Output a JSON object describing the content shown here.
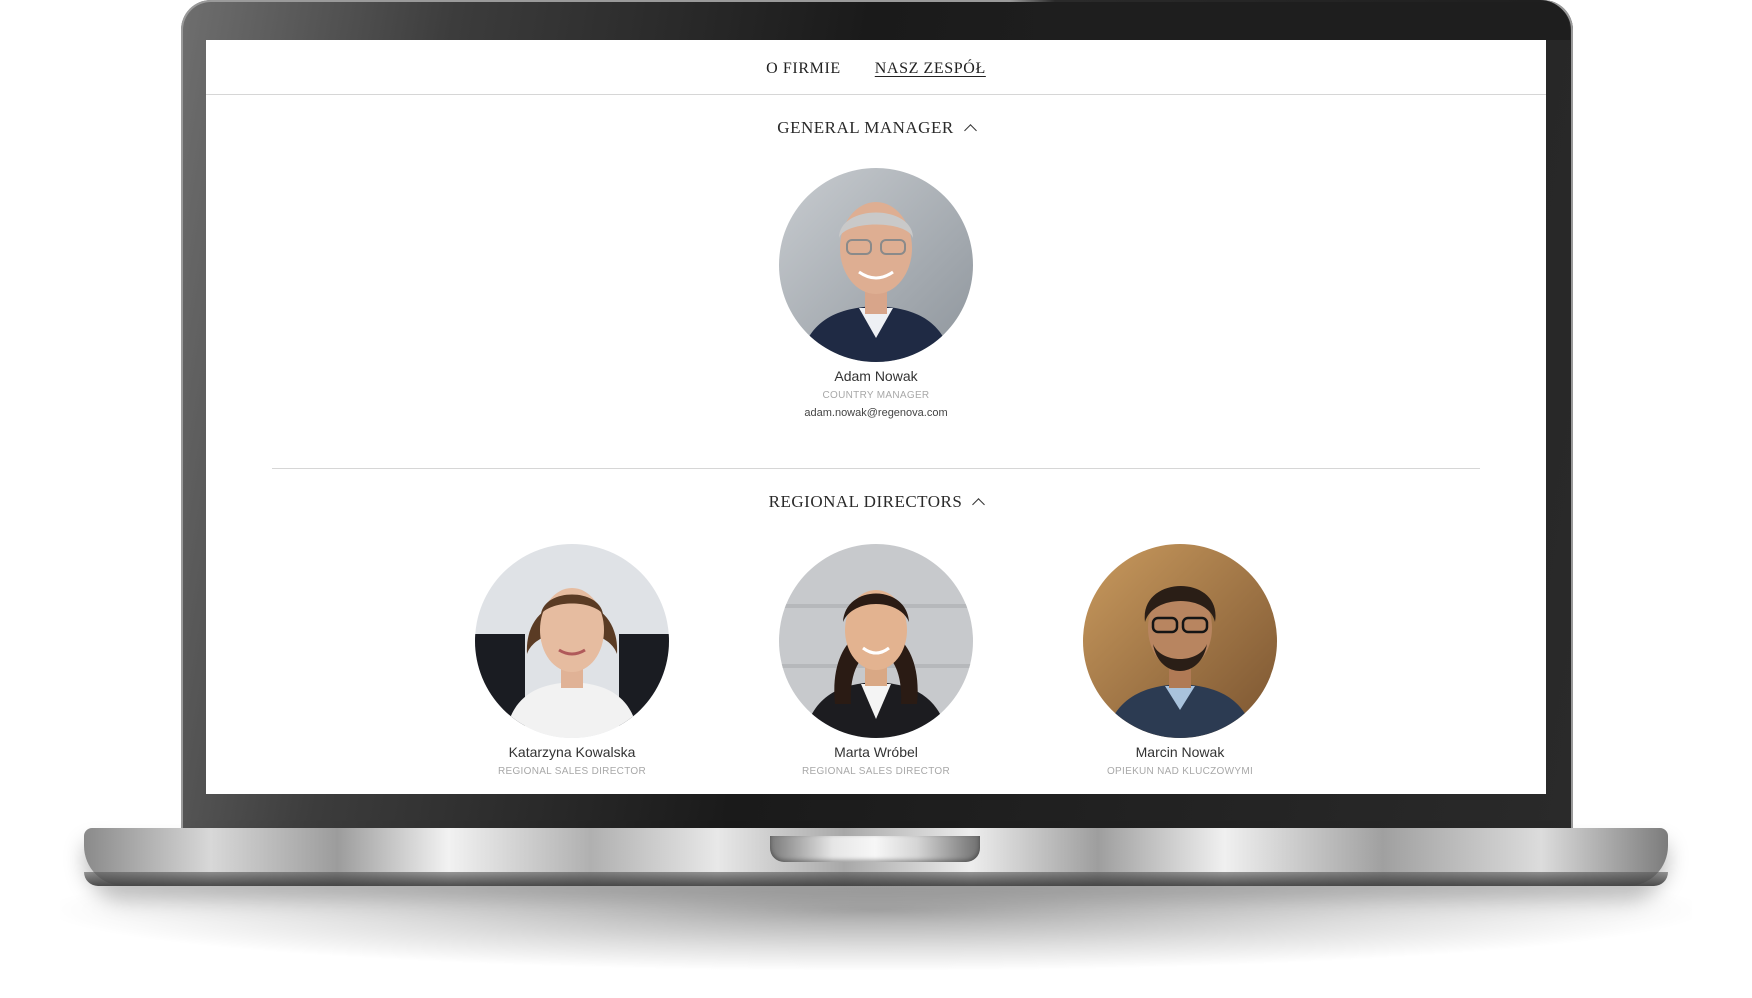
{
  "nav": {
    "items": [
      {
        "label": "O FIRMIE",
        "active": false
      },
      {
        "label": "NASZ ZESPÓŁ",
        "active": true
      }
    ]
  },
  "sections": [
    {
      "title": "GENERAL MANAGER",
      "icon": "chevron-up-icon",
      "people": [
        {
          "name": "Adam Nowak",
          "role": "COUNTRY MANAGER",
          "email": "adam.nowak@regenova.com"
        }
      ]
    },
    {
      "title": "REGIONAL DIRECTORS",
      "icon": "chevron-up-icon",
      "people": [
        {
          "name": "Katarzyna Kowalska",
          "role": "REGIONAL SALES DIRECTOR"
        },
        {
          "name": "Marta Wróbel",
          "role": "REGIONAL SALES DIRECTOR"
        },
        {
          "name": "Marcin Nowak",
          "role": "OPIEKUN NAD KLUCZOWYMI"
        }
      ]
    }
  ],
  "colors": {
    "laptop_frame": "#1a1a1a",
    "divider": "#d6d6d6",
    "role_text": "#a8a8a8"
  }
}
